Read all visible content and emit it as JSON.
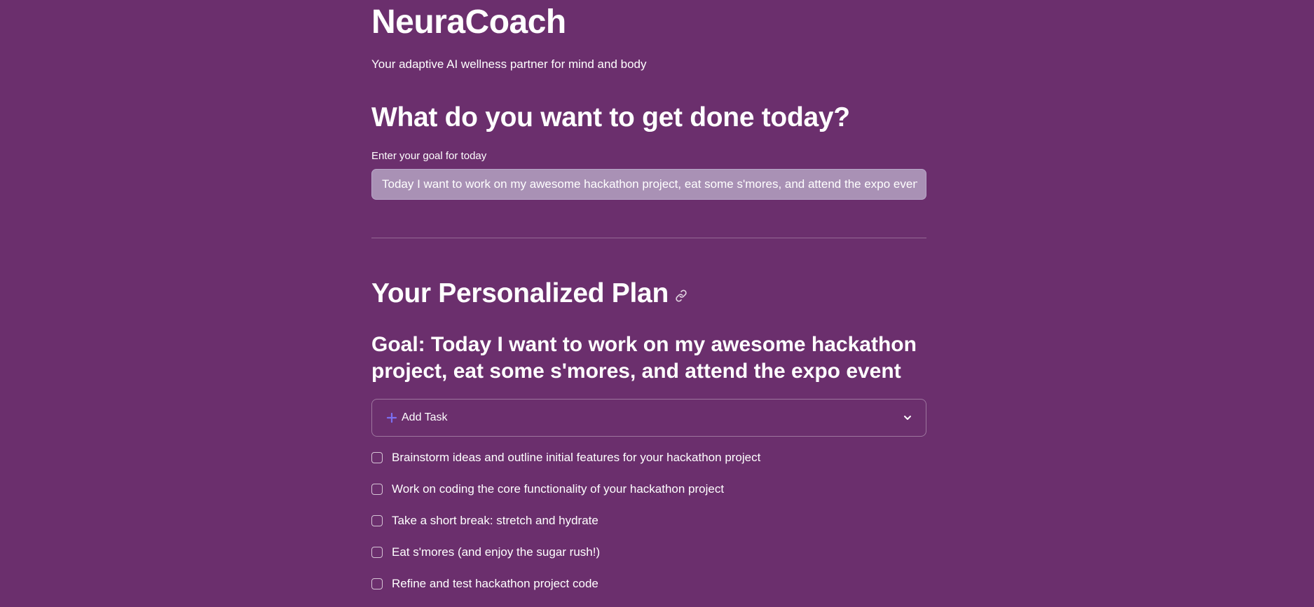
{
  "app": {
    "title": "NeuraCoach",
    "subtitle": "Your adaptive AI wellness partner for mind and body"
  },
  "goal_section": {
    "heading": "What do you want to get done today?",
    "input_label": "Enter your goal for today",
    "input_value": "Today I want to work on my awesome hackathon project, eat some s'mores, and attend the expo event"
  },
  "plan": {
    "heading": "Your Personalized Plan",
    "heading_icon": "link-icon",
    "goal_text": "Goal: Today I want to work on my awesome hackathon project, eat some s'mores, and attend the expo event",
    "add_task_label": "Add Task",
    "add_task_icon": "plus-icon",
    "expander_icon": "chevron-down-icon",
    "tasks": [
      {
        "label": "Brainstorm ideas and outline initial features for your hackathon project",
        "checked": false
      },
      {
        "label": "Work on coding the core functionality of your hackathon project",
        "checked": false
      },
      {
        "label": "Take a short break: stretch and hydrate",
        "checked": false
      },
      {
        "label": "Eat s'mores (and enjoy the sugar rush!)",
        "checked": false
      },
      {
        "label": "Refine and test hackathon project code",
        "checked": false
      }
    ]
  },
  "colors": {
    "background": "#6b2f6d",
    "input_background": "#a991b5",
    "accent": "#7b6ff0",
    "text": "#ffffff"
  }
}
